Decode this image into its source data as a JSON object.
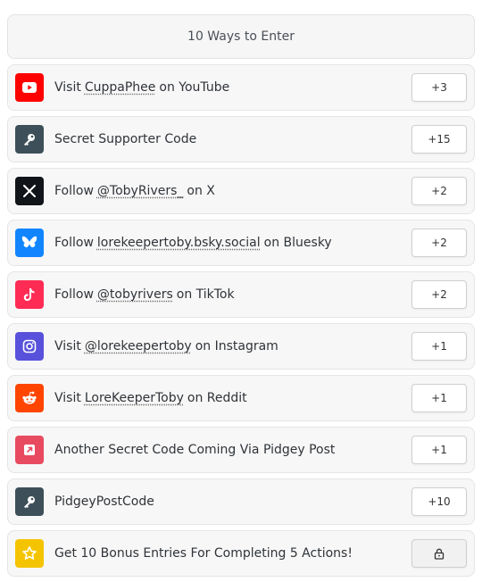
{
  "header": {
    "title": "10 Ways to Enter"
  },
  "entries": [
    {
      "icon": "youtube-icon",
      "color": "#ff0000",
      "pre": "Visit",
      "link": "CuppaPhee",
      "post": "on YouTube",
      "points": "+3"
    },
    {
      "icon": "key-icon",
      "color": "#3d4f59",
      "pre": "Secret Supporter Code",
      "link": "",
      "post": "",
      "points": "+15"
    },
    {
      "icon": "x-icon",
      "color": "#111418",
      "pre": "Follow",
      "link": "@TobyRivers_",
      "post": "on X",
      "points": "+2"
    },
    {
      "icon": "bluesky-icon",
      "color": "#1185fe",
      "pre": "Follow",
      "link": "lorekeepertoby.bsky.social",
      "post": "on Bluesky",
      "points": "+2"
    },
    {
      "icon": "tiktok-icon",
      "color": "#fe2c55",
      "pre": "Follow",
      "link": "@tobyrivers",
      "post": "on TikTok",
      "points": "+2"
    },
    {
      "icon": "instagram-icon",
      "color": "#5851db",
      "pre": "Visit",
      "link": "@lorekeepertoby",
      "post": "on Instagram",
      "points": "+1"
    },
    {
      "icon": "reddit-icon",
      "color": "#ff4500",
      "pre": "Visit",
      "link": "LoreKeeperToby",
      "post": "on Reddit",
      "points": "+1"
    },
    {
      "icon": "external-link-icon",
      "color": "#e84a5f",
      "pre": "Another Secret Code Coming Via Pidgey Post",
      "link": "",
      "post": "",
      "points": "+1"
    },
    {
      "icon": "key-icon",
      "color": "#3d4f59",
      "pre": "PidgeyPostCode",
      "link": "",
      "post": "",
      "points": "+10"
    },
    {
      "icon": "star-icon",
      "color": "#f5c400",
      "pre": "Get 10 Bonus Entries For Completing 5 Actions!",
      "link": "",
      "post": "",
      "points": ""
    }
  ]
}
